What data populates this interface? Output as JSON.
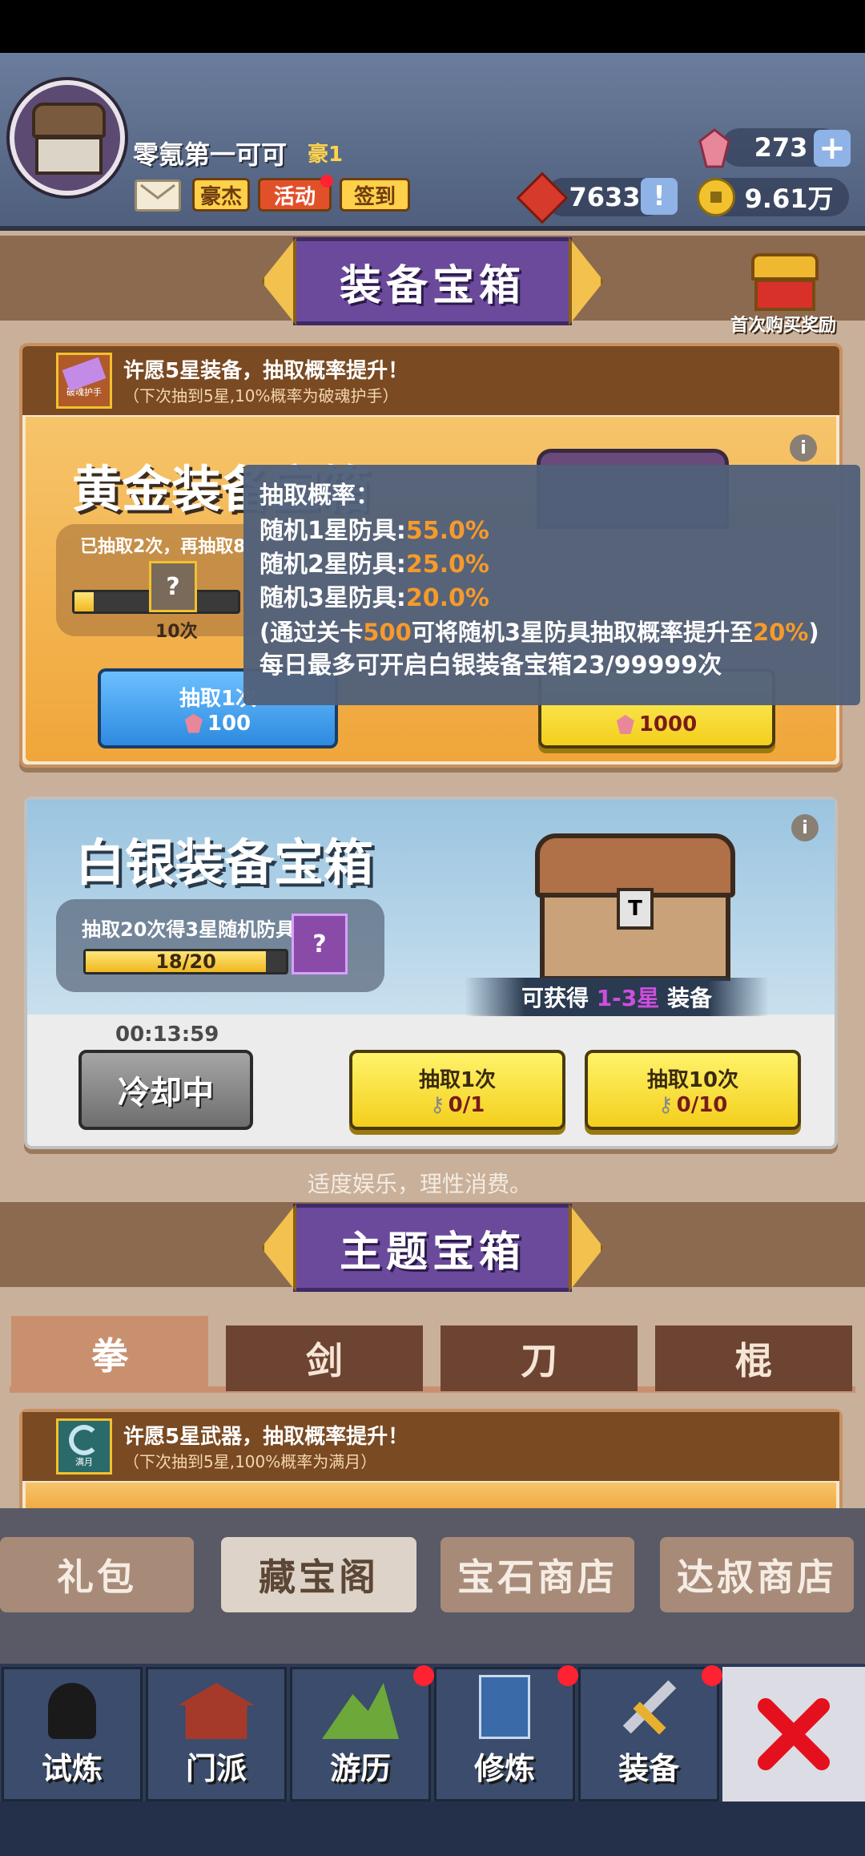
{
  "player": {
    "name": "零氪第一可可",
    "vip": "豪1",
    "mail_label": "",
    "tags": [
      "豪杰",
      "活动",
      "签到"
    ]
  },
  "resources": {
    "gems": "273",
    "honor": "7633",
    "coins": "9.61万"
  },
  "equip_banner": "装备宝箱",
  "first_purchase": "首次购买奖励",
  "gold_box": {
    "wish_title": "许愿5星装备，抽取概率提升！",
    "wish_sub": "（下次抽到5星,10%概率为破魂护手）",
    "wish_item_label": "破魂护手",
    "title": "黄金装备宝箱",
    "progress_text": "已抽取2次，再抽取8",
    "reward_count": "10次",
    "btn1_label": "抽取1次",
    "btn1_cost": "100",
    "btn10_cost": "1000"
  },
  "popup": {
    "title": "抽取概率：",
    "rows": [
      {
        "label": "随机1星防具:",
        "value": "55.0%"
      },
      {
        "label": "随机2星防具:",
        "value": "25.0%"
      },
      {
        "label": "随机3星防具:",
        "value": "20.0%"
      }
    ],
    "note_a": "(通过关卡",
    "note_stage": "500",
    "note_b": "可将随机3星防具抽取概率提升至",
    "note_pct": "20%",
    "note_c": ")",
    "daily": "每日最多可开启白银装备宝箱23/99999次"
  },
  "silver_box": {
    "title": "白银装备宝箱",
    "progress_label": "抽取20次得3星随机防具",
    "progress_text": "18/20",
    "progress_fraction": 0.9,
    "reward_prefix": "可获得",
    "reward_range": "1-3星",
    "reward_suffix": "装备",
    "timer": "00:13:59",
    "cooldown_label": "冷却中",
    "btn1_label": "抽取1次",
    "btn1_cost": "0/1",
    "btn10_label": "抽取10次",
    "btn10_cost": "0/10"
  },
  "moderation_note": "适度娱乐，理性消费。",
  "theme_banner": "主题宝箱",
  "theme_tabs": [
    "拳",
    "剑",
    "刀",
    "棍"
  ],
  "theme_box": {
    "wish_title": "许愿5星武器，抽取概率提升！",
    "wish_sub": "（下次抽到5星,100%概率为满月）",
    "wish_item_label": "满月"
  },
  "shop_tabs": [
    "礼包",
    "藏宝阁",
    "宝石商店",
    "达叔商店"
  ],
  "nav": [
    "试炼",
    "门派",
    "游历",
    "修炼",
    "装备"
  ],
  "colors": {
    "accent_orange": "#f59a2c",
    "purple_text": "#d04de0"
  }
}
